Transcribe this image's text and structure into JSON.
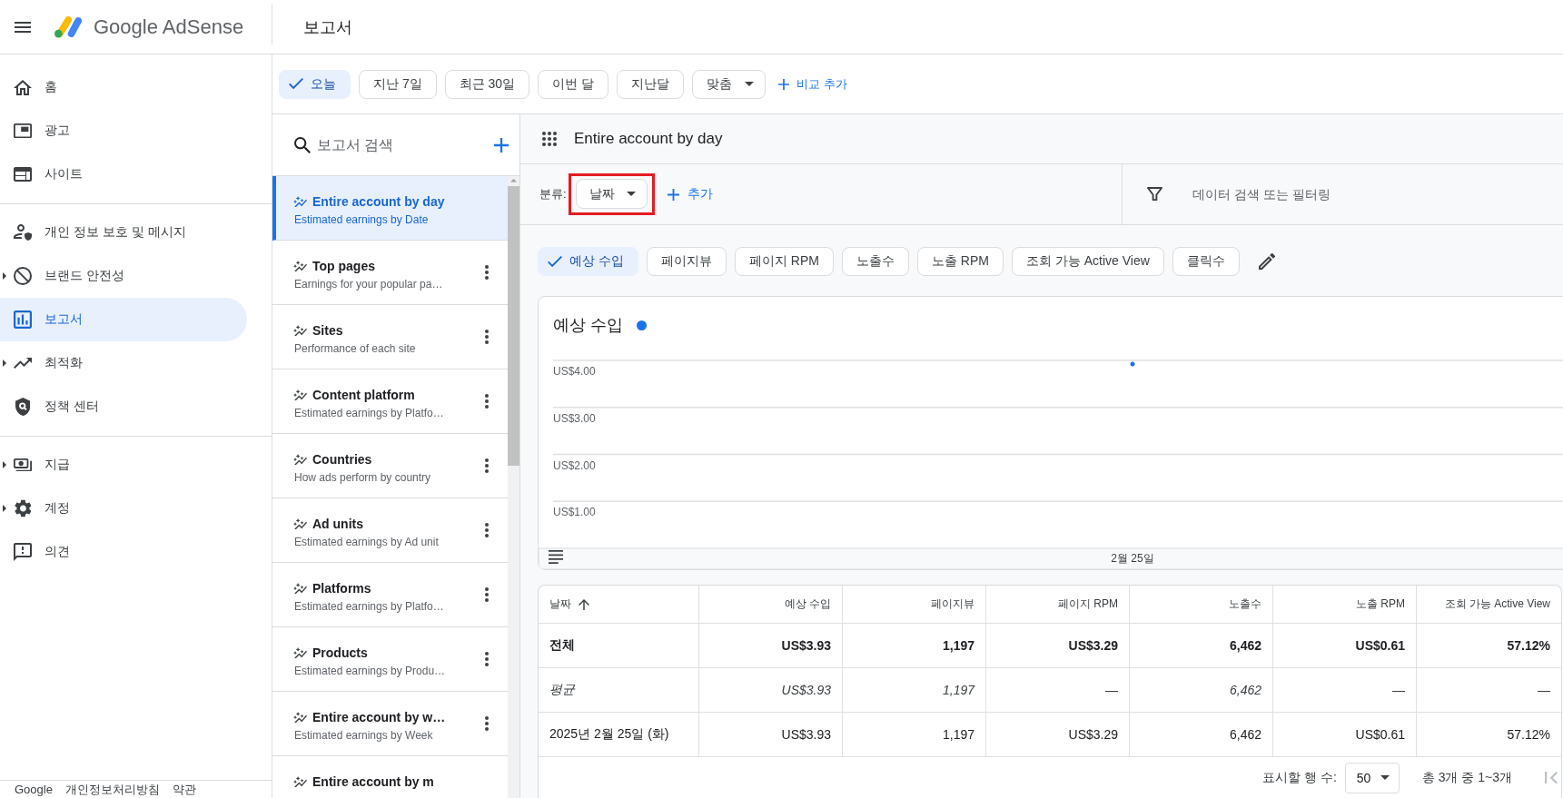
{
  "header": {
    "app_name": "Google AdSense",
    "page_title": "보고서"
  },
  "sidebar": {
    "sections": [
      {
        "items": [
          {
            "label": "홈",
            "expandable": false,
            "selected": false
          },
          {
            "label": "광고",
            "expandable": false,
            "selected": false
          },
          {
            "label": "사이트",
            "expandable": false,
            "selected": false
          }
        ]
      },
      {
        "items": [
          {
            "label": "개인 정보 보호 및 메시지",
            "expandable": false,
            "selected": false
          },
          {
            "label": "브랜드 안전성",
            "expandable": true,
            "selected": false
          },
          {
            "label": "보고서",
            "expandable": false,
            "selected": true
          },
          {
            "label": "최적화",
            "expandable": true,
            "selected": false
          },
          {
            "label": "정책 센터",
            "expandable": false,
            "selected": false
          }
        ]
      },
      {
        "items": [
          {
            "label": "지급",
            "expandable": true,
            "selected": false
          },
          {
            "label": "계정",
            "expandable": true,
            "selected": false
          },
          {
            "label": "의견",
            "expandable": false,
            "selected": false
          }
        ]
      }
    ],
    "footer_links": [
      "Google",
      "개인정보처리방침",
      "약관"
    ]
  },
  "date_ranges": [
    {
      "label": "오늘",
      "kind": "chip",
      "selected": true
    },
    {
      "label": "지난 7일",
      "kind": "chip",
      "selected": false
    },
    {
      "label": "최근 30일",
      "kind": "chip",
      "selected": false
    },
    {
      "label": "이번 달",
      "kind": "chip",
      "selected": false
    },
    {
      "label": "지난달",
      "kind": "chip",
      "selected": false
    },
    {
      "label": "맞춤",
      "kind": "dropdown",
      "selected": false
    }
  ],
  "compare_button": "비교 추가",
  "report_list": {
    "search": {
      "placeholder": "보고서 검색"
    },
    "reports": [
      {
        "title": "Entire account by day",
        "subtitle": "Estimated earnings by Date",
        "selected": true
      },
      {
        "title": "Top pages",
        "subtitle": "Earnings for your popular pa…",
        "selected": false
      },
      {
        "title": "Sites",
        "subtitle": "Performance of each site",
        "selected": false
      },
      {
        "title": "Content platform",
        "subtitle": "Estimated earnings by Platfo…",
        "selected": false
      },
      {
        "title": "Countries",
        "subtitle": "How ads perform by country",
        "selected": false
      },
      {
        "title": "Ad units",
        "subtitle": "Estimated earnings by Ad unit",
        "selected": false
      },
      {
        "title": "Platforms",
        "subtitle": "Estimated earnings by Platfo…",
        "selected": false
      },
      {
        "title": "Products",
        "subtitle": "Estimated earnings by Produ…",
        "selected": false
      },
      {
        "title": "Entire account by w…",
        "subtitle": "Estimated earnings by Week",
        "selected": false
      },
      {
        "title": "Entire account by m",
        "selected": false
      }
    ]
  },
  "main": {
    "report_title": "Entire account by day",
    "breakdown": {
      "label": "분류:",
      "value": "날짜",
      "highlighted": true
    },
    "add_breakdown": "추가",
    "filter": {
      "placeholder": "데이터 검색 또는 필터링"
    },
    "metrics": [
      {
        "label": "예상 수입",
        "selected": true
      },
      {
        "label": "페이지뷰",
        "selected": false
      },
      {
        "label": "페이지 RPM",
        "selected": false
      },
      {
        "label": "노출수",
        "selected": false
      },
      {
        "label": "노출 RPM",
        "selected": false
      },
      {
        "label": "조회 가능 Active View",
        "selected": false
      },
      {
        "label": "클릭수",
        "selected": false
      }
    ],
    "chart": {
      "legend": [
        {
          "label": "예상 수입",
          "color": "#1a73e8"
        }
      ],
      "y_axis_labels": [
        "US$4.00",
        "US$3.00",
        "US$2.00",
        "US$1.00"
      ],
      "x_axis_labels": [
        "2월 25일"
      ]
    },
    "table": {
      "columns": [
        {
          "label": "날짜",
          "sorted": true
        },
        {
          "label": "예상 수입",
          "sorted": false
        },
        {
          "label": "페이지뷰",
          "sorted": false
        },
        {
          "label": "페이지 RPM",
          "sorted": false
        },
        {
          "label": "노출수",
          "sorted": false
        },
        {
          "label": "노출 RPM",
          "sorted": false
        },
        {
          "label": "조회 가능 Active View",
          "sorted": false
        }
      ],
      "rows": [
        {
          "kind": "total",
          "cells": [
            "전체",
            "US$3.93",
            "1,197",
            "US$3.29",
            "6,462",
            "US$0.61",
            "57.12%"
          ]
        },
        {
          "kind": "average",
          "cells": [
            "평균",
            "US$3.93",
            "1,197",
            "—",
            "6,462",
            "—",
            "—"
          ]
        },
        {
          "kind": "data",
          "cells": [
            "2025년 2월 25일 (화)",
            "US$3.93",
            "1,197",
            "US$3.29",
            "6,462",
            "US$0.61",
            "57.12%"
          ]
        }
      ],
      "footer": {
        "rows_label": "표시할 행 수:",
        "rows_per_page": "50",
        "range": "총 3개 중 1~3개"
      }
    }
  }
}
